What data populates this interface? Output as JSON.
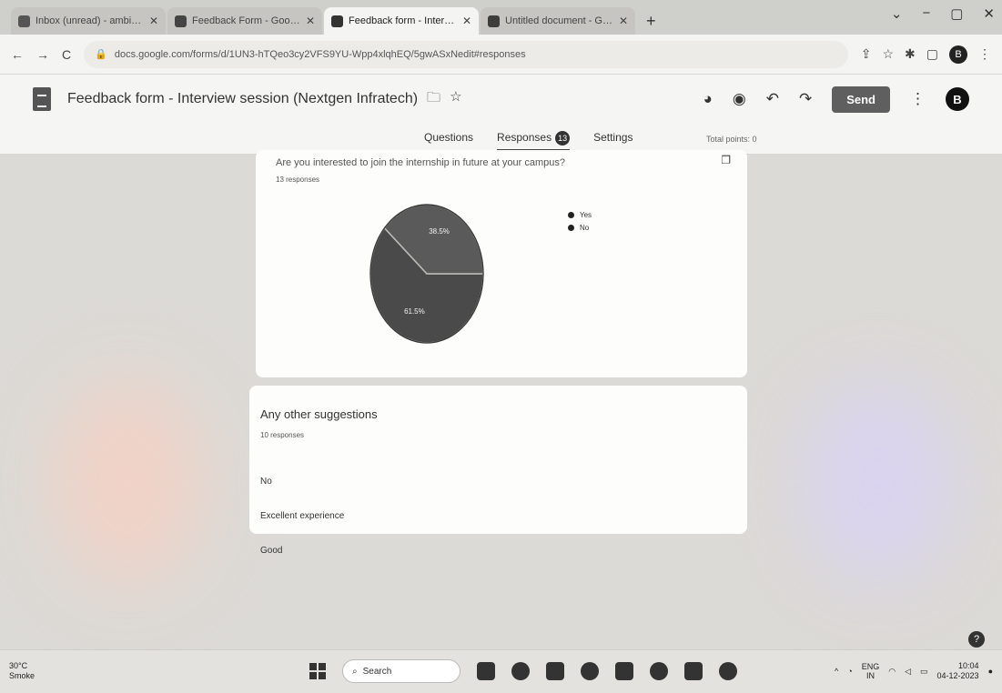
{
  "browser": {
    "tabs": [
      {
        "label": "Inbox (unread) - ambimdegt@...",
        "active": false,
        "fav_color": "#555555"
      },
      {
        "label": "Feedback Form - Google Drive",
        "active": false,
        "fav_color": "#444444"
      },
      {
        "label": "Feedback form - Interview sessi",
        "active": true,
        "fav_color": "#333333"
      },
      {
        "label": "Untitled document - Google D",
        "active": false,
        "fav_color": "#3d3d3d"
      }
    ],
    "new_tab": "+",
    "url": "docs.google.com/forms/d/1UN3-hTQeo3cy2VFS9YU-Wpp4xlqhEQ/5gwASxNedit#responses",
    "window_controls": [
      "⌄",
      "−",
      "▢",
      "✕"
    ]
  },
  "header": {
    "title": "Feedback form - Interview session (Nextgen Infratech)",
    "send_label": "Send",
    "avatar_letter": "B"
  },
  "nav": {
    "tabs": [
      "Questions",
      "Responses",
      "Settings"
    ],
    "responses_count": "13",
    "total_points": "Total points: 0"
  },
  "question1": {
    "text": "Are you interested to join the internship in future at your campus?",
    "response_count": "13 responses"
  },
  "chart_data": {
    "type": "pie",
    "title": "",
    "labels": [
      "Yes",
      "No"
    ],
    "values": [
      61.5,
      38.5
    ],
    "value_labels": [
      "61.5%",
      "38.5%"
    ],
    "colors": [
      "#4a4a4a",
      "#5a5a5a"
    ],
    "legend_position": "right"
  },
  "question2": {
    "title": "Any other suggestions",
    "response_count": "10 responses",
    "answers": [
      "No",
      "Excellent experience",
      "Good"
    ]
  },
  "taskbar": {
    "weather_temp": "30°C",
    "weather_desc": "Smoke",
    "search_label": "Search",
    "lang": "ENG",
    "lang_sub": "IN",
    "time": "10:04",
    "date": "04-12-2023"
  }
}
